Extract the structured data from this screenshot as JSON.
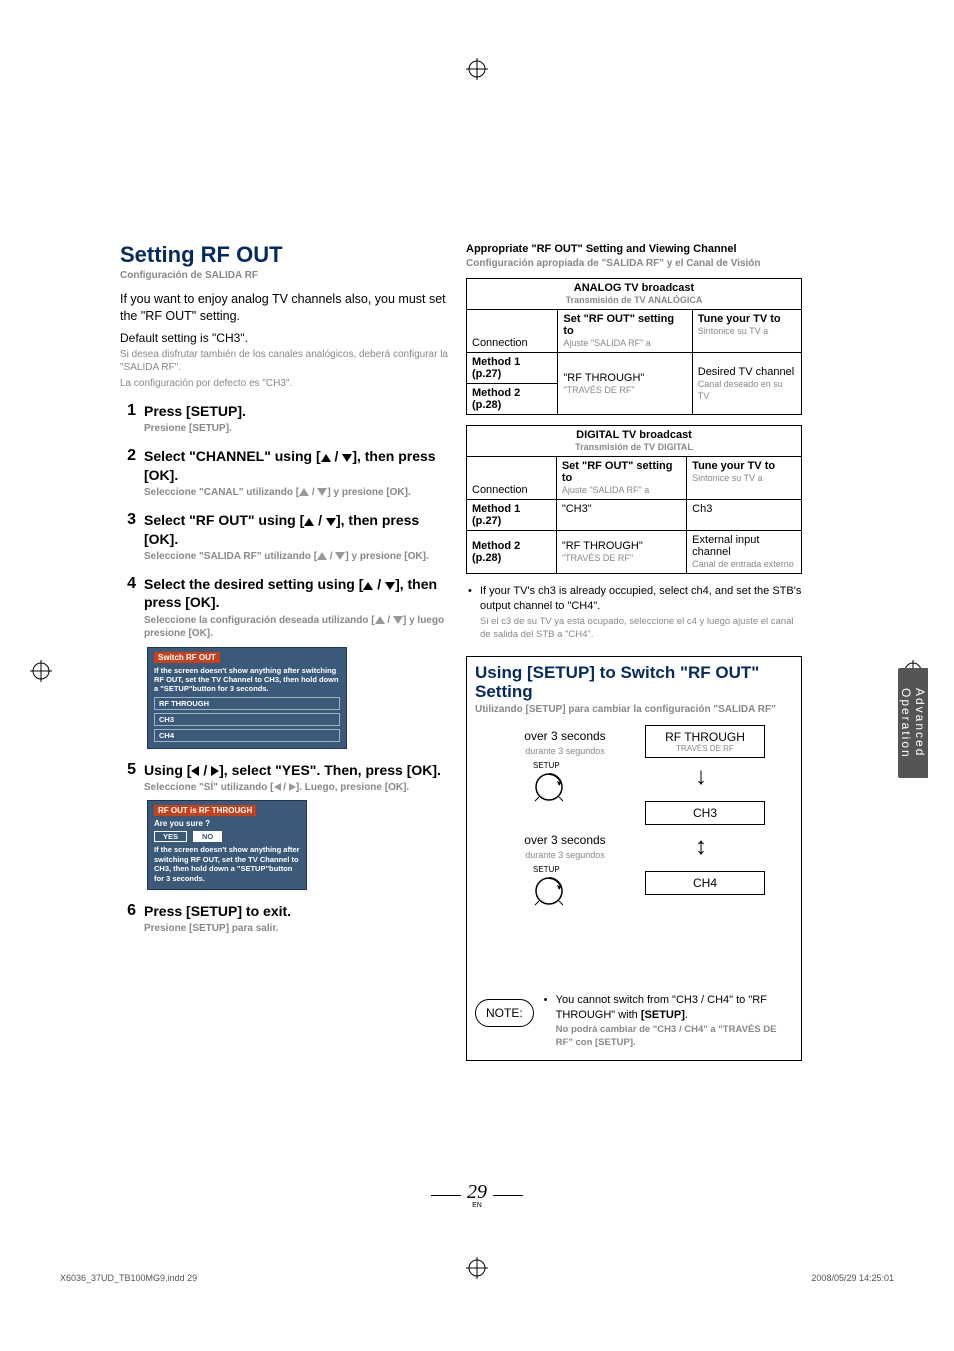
{
  "page": {
    "number": "29",
    "lang": "EN"
  },
  "footer": {
    "file": "X6036_37UD_TB100MG9.indd   29",
    "timestamp": "2008/05/29   14:25:01"
  },
  "tab": {
    "line1": "Advanced",
    "line2": "Operation"
  },
  "left": {
    "h1": "Setting RF OUT",
    "h1_es": "Configuración de SALIDA RF",
    "intro_en": "If you want to enjoy analog TV channels also, you must set the \"RF OUT\" setting.",
    "default_en": "Default setting is \"CH3\".",
    "intro_es1": "Si desea disfrutar también de los canales analógicos, deberá configurar la \"SALIDA RF\".",
    "intro_es2": "La configuración por defecto es \"CH3\".",
    "steps": [
      {
        "num": "1",
        "en": "Press [SETUP].",
        "es": "Presione [SETUP]."
      },
      {
        "num": "2",
        "en_pre": "Select \"CHANNEL\" using [",
        "en_post": "], then press [OK].",
        "es_pre": "Seleccione \"CANAL\" utilizando [",
        "es_post": "] y presione [OK]."
      },
      {
        "num": "3",
        "en_pre": "Select \"RF OUT\" using [",
        "en_post": "], then press [OK].",
        "es_pre": "Seleccione \"SALIDA RF\" utilizando [",
        "es_post": "] y presione [OK]."
      },
      {
        "num": "4",
        "en_pre": "Select the desired setting using [",
        "en_post": "], then press [OK].",
        "es_pre": "Seleccione la configuración deseada utilizando [",
        "es_post": "] y luego presione [OK]."
      },
      {
        "num": "5",
        "en_pre": "Using [",
        "en_post": "], select \"YES\". Then, press [OK].",
        "es_pre": "Seleccione \"SÍ\" utilizando [",
        "es_post": "]. Luego, presione [OK]."
      },
      {
        "num": "6",
        "en": "Press [SETUP] to exit.",
        "es": "Presione [SETUP] para salir."
      }
    ],
    "osd1": {
      "title": "Switch RF OUT",
      "body": "If the screen doesn't show anything after switching RF OUT, set the TV Channel to CH3, then hold down a \"SETUP\"button for 3 seconds.",
      "rows": [
        "RF THROUGH",
        "CH3",
        "CH4"
      ]
    },
    "osd2": {
      "title": "RF OUT is RF THROUGH",
      "q": "Are you sure ?",
      "yes": "YES",
      "no": "NO",
      "body": "If the screen doesn't show anything after switching RF OUT, set the TV Channel to CH3, then hold down a \"SETUP\"button for 3 seconds."
    }
  },
  "right": {
    "h_en": "Appropriate \"RF OUT\" Setting and Viewing Channel",
    "h_es": "Configuración apropiada de \"SALIDA RF\" y el Canal de Visión",
    "table1": {
      "title_en": "ANALOG TV broadcast",
      "title_es": "Transmisión de TV ANALÓGICA",
      "r1c1": "Connection",
      "r1c2_en": "Set \"RF OUT\" setting to",
      "r1c2_es": "Ajuste \"SALIDA RF\" a",
      "r1c3_en": "Tune your TV to",
      "r1c3_es": "Sintonice su TV a",
      "m1": "Method 1 (p.27)",
      "m2": "Method 2 (p.28)",
      "val_en": "\"RF THROUGH\"",
      "val_es": "\"TRAVÉS DE RF\"",
      "tv_en": "Desired TV channel",
      "tv_es": "Canal deseado en su TV"
    },
    "table2": {
      "title_en": "DIGITAL TV broadcast",
      "title_es": "Transmisión de TV DIGITAL",
      "r1c1": "Connection",
      "r1c2_en": "Set \"RF OUT\" setting to",
      "r1c2_es": "Ajuste \"SALIDA RF\" a",
      "r1c3_en": "Tune your TV to",
      "r1c3_es": "Sintonice su TV a",
      "m1": "Method 1 (p.27)",
      "m1v": "\"CH3\"",
      "m1t": "Ch3",
      "m2": "Method 2 (p.28)",
      "m2v_en": "\"RF THROUGH\"",
      "m2v_es": "\"TRAVÉS DE RF\"",
      "m2t_en": "External input channel",
      "m2t_es": "Canal de entrada externo"
    },
    "bullet_en": "If your TV's ch3 is already occupied, select ch4, and set the STB's output channel to \"CH4\".",
    "bullet_es": "Si el c3 de su TV ya está ocupado, seleccione el c4 y luego ajuste el canal de salida del STB a \"CH4\".",
    "sec2_h": "Using [SETUP] to Switch \"RF OUT\" Setting",
    "sec2_es": "Utilizando [SETUP] para cambiar la configuración \"SALIDA RF\"",
    "flow": {
      "over_en": "over 3 seconds",
      "over_es": "durante 3 segundos",
      "setup": "SETUP",
      "box1_en": "RF THROUGH",
      "box1_es": "TRAVÉS DE RF",
      "box2": "CH3",
      "box3": "CH4"
    },
    "note_label": "NOTE:",
    "note_en_1": "You cannot switch from \"CH3 / CH4\" to \"RF THROUGH\" with ",
    "note_en_2": "[SETUP]",
    "note_en_3": ".",
    "note_es_1": "No podrá cambiar de \"CH3 / CH4\" a \"TRAVÉS DE RF\" con ",
    "note_es_2": "[SETUP]",
    "note_es_3": "."
  }
}
